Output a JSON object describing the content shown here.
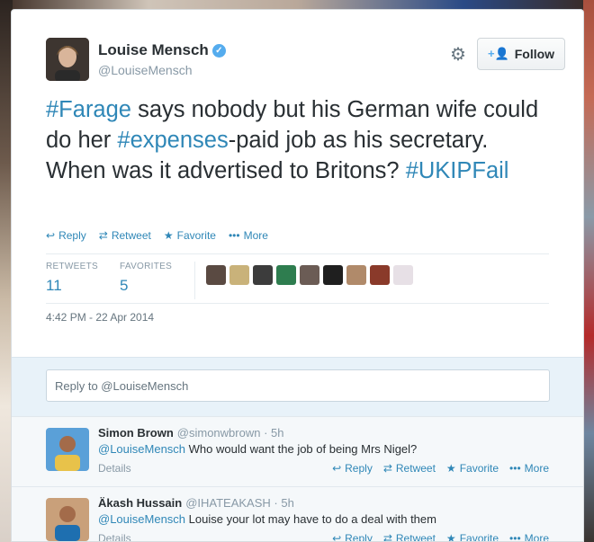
{
  "tweet": {
    "author_name": "Louise Mensch",
    "author_handle": "@LouiseMensch",
    "follow_label": "Follow",
    "text_segments": [
      {
        "t": "#Farage",
        "tag": true
      },
      {
        "t": " says nobody but his German wife could do her ",
        "tag": false
      },
      {
        "t": "#expenses",
        "tag": true
      },
      {
        "t": "-paid job as his secretary. When was it advertised to Britons? ",
        "tag": false
      },
      {
        "t": "#UKIPFail",
        "tag": true
      }
    ],
    "actions": {
      "reply": "Reply",
      "retweet": "Retweet",
      "favorite": "Favorite",
      "more": "More"
    },
    "stats": {
      "retweets_label": "RETWEETS",
      "retweets_value": "11",
      "favorites_label": "FAVORITES",
      "favorites_value": "5"
    },
    "timestamp": "4:42 PM - 22 Apr 2014",
    "favoriter_avatar_colors": [
      "#5a4a42",
      "#c9b27a",
      "#3c3c3c",
      "#2e7d4f",
      "#6b5c55",
      "#1f1f1f",
      "#b08a6a",
      "#8a3a2a",
      "#e7e0e6"
    ]
  },
  "reply_box": {
    "placeholder": "Reply to @LouiseMensch"
  },
  "replies": [
    {
      "name": "Simon Brown",
      "handle": "@simonwbrown",
      "time": "· 5h",
      "mention": "@LouiseMensch",
      "text": " Who would want the job of being Mrs Nigel?",
      "details": "Details",
      "actions": {
        "reply": "Reply",
        "retweet": "Retweet",
        "favorite": "Favorite",
        "more": "More"
      }
    },
    {
      "name": "Äkash Hussain",
      "handle": "@IHATEAKASH",
      "time": "· 5h",
      "mention": "@LouiseMensch",
      "text": " Louise your lot may have to do a deal with them",
      "details": "Details",
      "actions": {
        "reply": "Reply",
        "retweet": "Retweet",
        "favorite": "Favorite",
        "more": "More"
      }
    }
  ],
  "colors": {
    "link": "#2f87b7",
    "text": "#292f33",
    "muted": "#8899a6",
    "verified": "#55acee"
  }
}
